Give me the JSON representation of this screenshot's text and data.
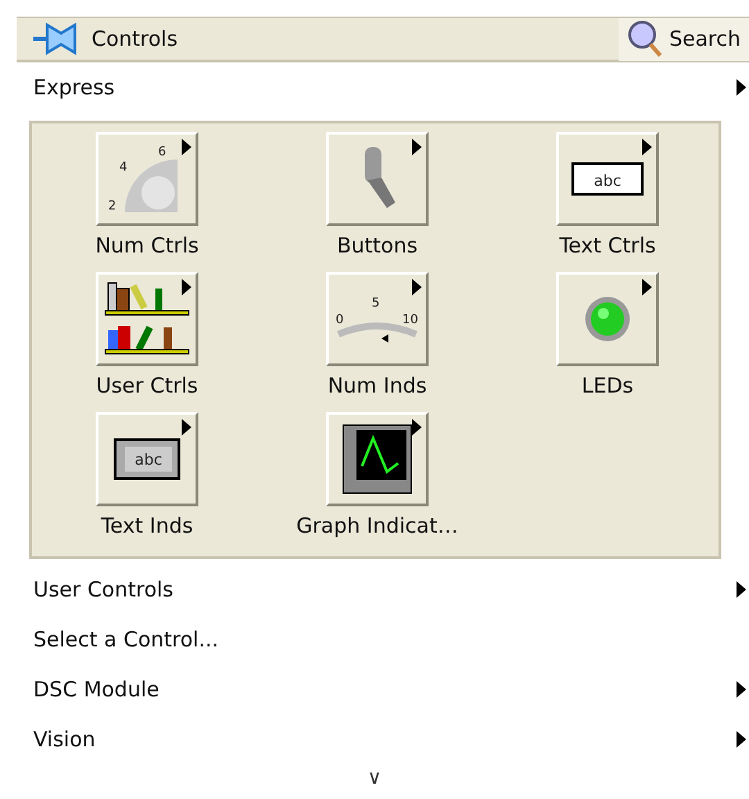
{
  "palette": {
    "title": "Controls",
    "search_button": "Search"
  },
  "express": {
    "label": "Express",
    "has_submenu": true
  },
  "items": [
    {
      "label": "Num Ctrls",
      "kind": "knob",
      "scale": [
        "2",
        "4",
        "6"
      ]
    },
    {
      "label": "Buttons",
      "kind": "toggle"
    },
    {
      "label": "Text Ctrls",
      "kind": "textbox",
      "text": "abc"
    },
    {
      "label": "User Ctrls",
      "kind": "shelf"
    },
    {
      "label": "Num Inds",
      "kind": "gauge",
      "scale": [
        "0",
        "5",
        "10"
      ]
    },
    {
      "label": "LEDs",
      "kind": "led"
    },
    {
      "label": "Text Inds",
      "kind": "indicator",
      "text": "abc"
    },
    {
      "label": "Graph Indicat…",
      "kind": "graph"
    }
  ],
  "menu": [
    {
      "label": "User Controls",
      "has_submenu": true
    },
    {
      "label": "Select a Control...",
      "has_submenu": false
    },
    {
      "label": "DSC Module",
      "has_submenu": true
    },
    {
      "label": "Vision",
      "has_submenu": true
    }
  ],
  "more": "∨"
}
